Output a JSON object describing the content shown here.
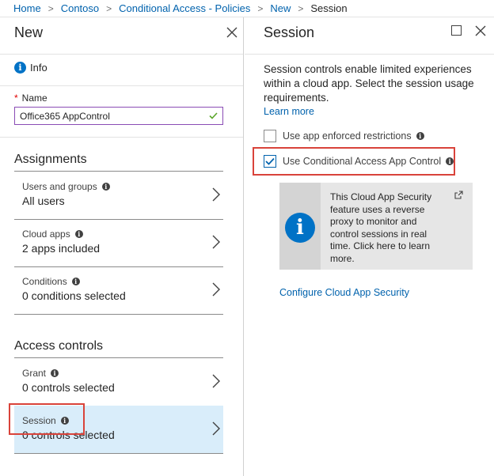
{
  "breadcrumb": {
    "items": [
      "Home",
      "Contoso",
      "Conditional Access - Policies",
      "New"
    ],
    "current": "Session",
    "separator": ">"
  },
  "left_blade": {
    "title": "New",
    "info_label": "Info",
    "name": {
      "required_mark": "*",
      "label": "Name",
      "value": "Office365 AppControl"
    },
    "assignments": {
      "title": "Assignments",
      "rows": [
        {
          "label": "Users and groups",
          "value": "All users"
        },
        {
          "label": "Cloud apps",
          "value": "2 apps included"
        },
        {
          "label": "Conditions",
          "value": "0 conditions selected"
        }
      ]
    },
    "access_controls": {
      "title": "Access controls",
      "rows": [
        {
          "label": "Grant",
          "value": "0 controls selected"
        },
        {
          "label": "Session",
          "value": "0 controls selected"
        }
      ]
    }
  },
  "right_blade": {
    "title": "Session",
    "description": "Session controls enable limited experiences within a cloud app. Select the session usage requirements.",
    "learn_more": "Learn more",
    "options": [
      {
        "label": "Use app enforced restrictions",
        "checked": false
      },
      {
        "label": "Use Conditional Access App Control",
        "checked": true
      }
    ],
    "info_card": "This Cloud App Security feature uses a reverse proxy to monitor and control sessions in real time. Click here to learn more.",
    "configure_link": "Configure Cloud App Security"
  },
  "colors": {
    "link": "#0062ad",
    "accent_blue": "#0072c6",
    "highlight_red": "#d9433a",
    "selected_row": "#d9edfa",
    "valid_check": "#5ba62b",
    "input_border": "#8a4cb5"
  },
  "icons": [
    "info-icon",
    "close-icon",
    "maximize-icon",
    "chevron-right-icon",
    "checkmark-icon",
    "external-link-icon"
  ]
}
